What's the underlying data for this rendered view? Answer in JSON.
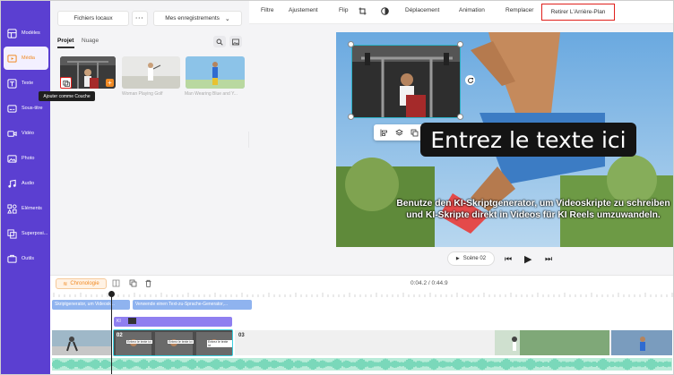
{
  "nav": {
    "items": [
      {
        "label": "Modèles",
        "icon": "templates-icon"
      },
      {
        "label": "Média",
        "icon": "media-icon"
      },
      {
        "label": "Texte",
        "icon": "text-icon"
      },
      {
        "label": "Sous-titre",
        "icon": "subtitle-icon"
      },
      {
        "label": "Vidéo",
        "icon": "video-icon"
      },
      {
        "label": "Photo",
        "icon": "photo-icon"
      },
      {
        "label": "Audio",
        "icon": "audio-icon"
      },
      {
        "label": "Eléments",
        "icon": "elements-icon"
      },
      {
        "label": "Superposi...",
        "icon": "overlay-icon"
      },
      {
        "label": "Outils",
        "icon": "tools-icon"
      }
    ],
    "active_index": 1
  },
  "media": {
    "local_files": "Fichiers locaux",
    "recordings": "Mes enregistrements",
    "tabs": [
      "Projet",
      "Nuage"
    ],
    "tooltip": "Ajouter comme Couche",
    "thumbs": [
      {
        "caption": ""
      },
      {
        "caption": "Woman Playing Golf"
      },
      {
        "caption": "Man Wearing Blue and Y..."
      }
    ]
  },
  "toolbar": {
    "items": [
      "Filtre",
      "Ajustement",
      "Flip",
      "Déplacement",
      "Animation",
      "Remplacer"
    ],
    "remove_bg": "Retirer L'Arrière-Plan"
  },
  "canvas": {
    "title_text": "Entrez le texte ici",
    "subtitle": "Benutze den KI-Skriptgenerator, um Videoskripte zu schreiben und KI-Skripte direkt in Videos für KI Reels umzuwandeln.",
    "scene_label": "Scène 02"
  },
  "timeline": {
    "label": "Chronologie",
    "time": "0:04.2 / 0:44.9",
    "subtitle_clip_1": "Skriptgenerator, um Videosk...",
    "subtitle_clip_2": "Verwende einen Text-zu-Sprache-Generator,...",
    "ai_clip": "KI",
    "clip_02": "02",
    "clip_03": "03",
    "overlay_tags": [
      "Entrez le texte ici",
      "Entrez le texte ici",
      "Entrez le texte ici"
    ]
  },
  "colors": {
    "nav_bg": "#5b3fd1",
    "accent": "#f08a24",
    "remove_bg_border": "#e0201c",
    "subtitle_track": "#8fb3ef",
    "ai_track": "#8f7ff0"
  }
}
